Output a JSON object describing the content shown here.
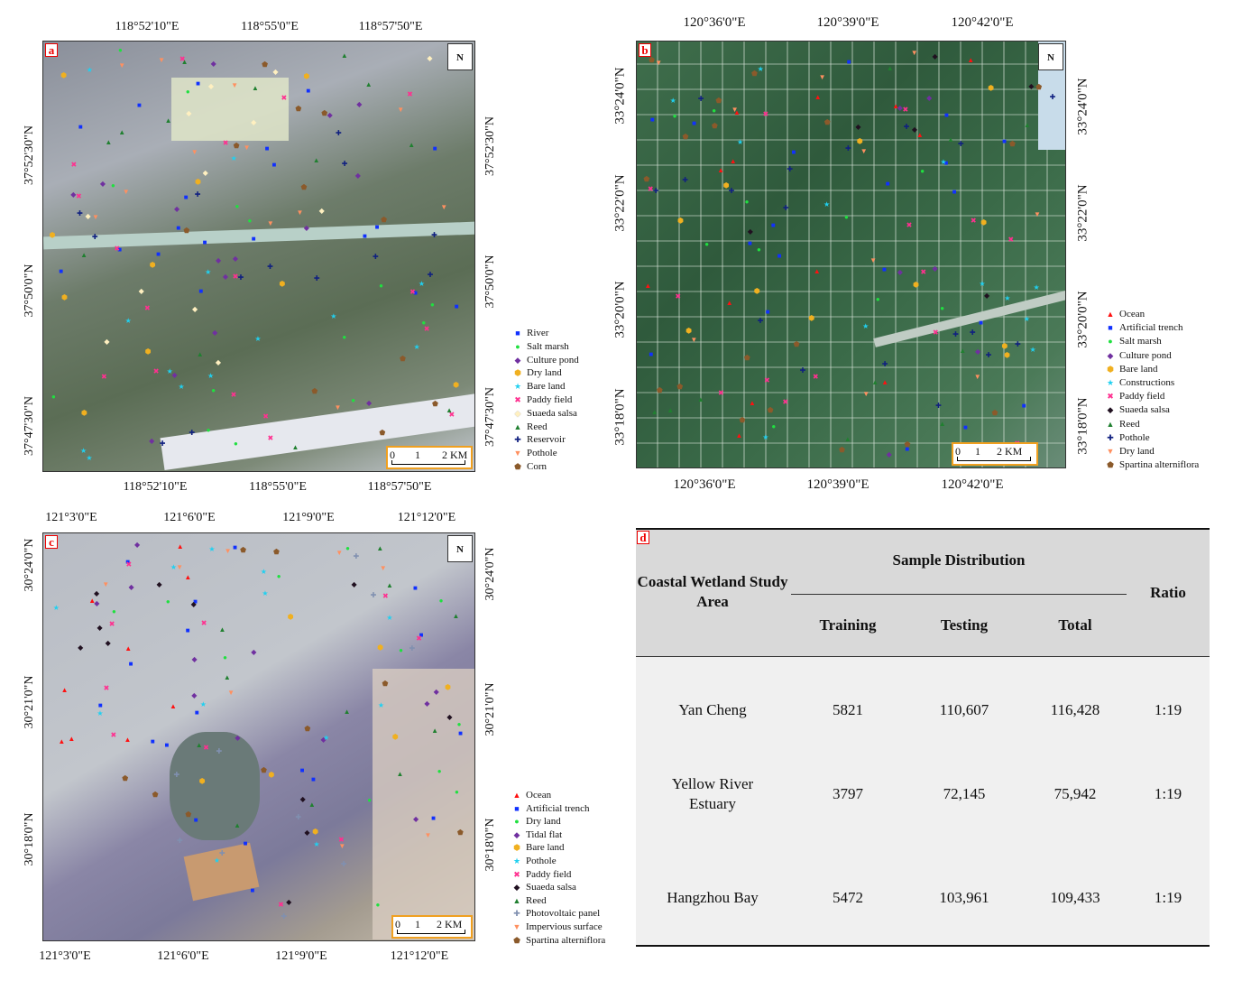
{
  "panels": {
    "a": {
      "tag": "a",
      "top_ticks": [
        "118°52'10\"E",
        "118°55'0\"E",
        "118°57'50\"E"
      ],
      "bottom_ticks": [
        "118°52'10\"E",
        "118°55'0\"E",
        "118°57'50\"E"
      ],
      "left_ticks": [
        "37°52'30\"N",
        "37°50'0\"N",
        "37°47'30\"N"
      ],
      "right_ticks": [
        "37°52'30\"N",
        "37°50'0\"N",
        "37°47'30\"N"
      ],
      "scale": {
        "t0": "0",
        "t1": "1",
        "t2": "2 KM"
      },
      "legend": [
        {
          "label": "River",
          "symbol": "■",
          "color": "#1030ff"
        },
        {
          "label": "Salt marsh",
          "symbol": "●",
          "color": "#20e040"
        },
        {
          "label": "Culture pond",
          "symbol": "◆",
          "color": "#7030a0"
        },
        {
          "label": "Dry land",
          "symbol": "⬢",
          "color": "#f0b020"
        },
        {
          "label": "Bare land",
          "symbol": "★",
          "color": "#20d0f0"
        },
        {
          "label": "Paddy field",
          "symbol": "✖",
          "color": "#ff3090"
        },
        {
          "label": "Suaeda salsa",
          "symbol": "◆",
          "color": "#fff0c0"
        },
        {
          "label": "Reed",
          "symbol": "▲",
          "color": "#208030"
        },
        {
          "label": "Reservoir",
          "symbol": "✚",
          "color": "#102080"
        },
        {
          "label": "Pothole",
          "symbol": "▼",
          "color": "#ff9060"
        },
        {
          "label": "Corn",
          "symbol": "⬟",
          "color": "#8b5a2b"
        }
      ]
    },
    "b": {
      "tag": "b",
      "top_ticks": [
        "120°36'0\"E",
        "120°39'0\"E",
        "120°42'0\"E"
      ],
      "bottom_ticks": [
        "120°36'0\"E",
        "120°39'0\"E",
        "120°42'0\"E"
      ],
      "left_ticks": [
        "33°24'0\"N",
        "33°22'0\"N",
        "33°20'0\"N",
        "33°18'0\"N"
      ],
      "right_ticks": [
        "33°24'0\"N",
        "33°22'0\"N",
        "33°20'0\"N",
        "33°18'0\"N"
      ],
      "scale": {
        "t0": "0",
        "t1": "1",
        "t2": "2 KM"
      },
      "legend": [
        {
          "label": "Ocean",
          "symbol": "▲",
          "color": "#ff1010"
        },
        {
          "label": "Artificial trench",
          "symbol": "■",
          "color": "#1030ff"
        },
        {
          "label": "Salt marsh",
          "symbol": "●",
          "color": "#20e040"
        },
        {
          "label": "Culture pond",
          "symbol": "◆",
          "color": "#7030a0"
        },
        {
          "label": "Bare land",
          "symbol": "⬢",
          "color": "#f0b020"
        },
        {
          "label": "Constructions",
          "symbol": "★",
          "color": "#20d0f0"
        },
        {
          "label": "Paddy field",
          "symbol": "✖",
          "color": "#ff3090"
        },
        {
          "label": "Suaeda salsa",
          "symbol": "◆",
          "color": "#201020"
        },
        {
          "label": "Reed",
          "symbol": "▲",
          "color": "#208030"
        },
        {
          "label": "Pothole",
          "symbol": "✚",
          "color": "#102080"
        },
        {
          "label": "Dry land",
          "symbol": "▼",
          "color": "#ff9060"
        },
        {
          "label": "Spartina alterniflora",
          "symbol": "⬟",
          "color": "#8b5a2b"
        }
      ]
    },
    "c": {
      "tag": "c",
      "top_ticks": [
        "121°3'0\"E",
        "121°6'0\"E",
        "121°9'0\"E",
        "121°12'0\"E"
      ],
      "bottom_ticks": [
        "121°3'0\"E",
        "121°6'0\"E",
        "121°9'0\"E",
        "121°12'0\"E"
      ],
      "left_ticks": [
        "30°24'0\"N",
        "30°21'0\"N",
        "30°18'0\"N"
      ],
      "right_ticks": [
        "30°24'0\"N",
        "30°21'0\"N",
        "30°18'0\"N"
      ],
      "scale": {
        "t0": "0",
        "t1": "1",
        "t2": "2 KM"
      },
      "legend": [
        {
          "label": "Ocean",
          "symbol": "▲",
          "color": "#ff1010"
        },
        {
          "label": "Artificial trench",
          "symbol": "■",
          "color": "#1030ff"
        },
        {
          "label": "Dry land",
          "symbol": "●",
          "color": "#20e040"
        },
        {
          "label": "Tidal flat",
          "symbol": "◆",
          "color": "#7030a0"
        },
        {
          "label": "Bare land",
          "symbol": "⬢",
          "color": "#f0b020"
        },
        {
          "label": "Pothole",
          "symbol": "★",
          "color": "#20d0f0"
        },
        {
          "label": "Paddy field",
          "symbol": "✖",
          "color": "#ff3090"
        },
        {
          "label": "Suaeda salsa",
          "symbol": "◆",
          "color": "#201020"
        },
        {
          "label": "Reed",
          "symbol": "▲",
          "color": "#208030"
        },
        {
          "label": "Photovoltaic panel",
          "symbol": "✚",
          "color": "#8090b0"
        },
        {
          "label": "Impervious surface",
          "symbol": "▼",
          "color": "#ff9060"
        },
        {
          "label": "Spartina alterniflora",
          "symbol": "⬟",
          "color": "#8b5a2b"
        }
      ]
    }
  },
  "table": {
    "tag": "d",
    "col_area": "Coastal Wetland Study Area",
    "group": "Sample Distribution",
    "col_training": "Training",
    "col_testing": "Testing",
    "col_total": "Total",
    "col_ratio": "Ratio",
    "rows": [
      {
        "area": "Yan Cheng",
        "training": "5821",
        "testing": "110,607",
        "total": "116,428",
        "ratio": "1:19"
      },
      {
        "area": "Yellow River Estuary",
        "training": "3797",
        "testing": "72,145",
        "total": "75,942",
        "ratio": "1:19"
      },
      {
        "area": "Hangzhou Bay",
        "training": "5472",
        "testing": "103,961",
        "total": "109,433",
        "ratio": "1:19"
      }
    ]
  }
}
